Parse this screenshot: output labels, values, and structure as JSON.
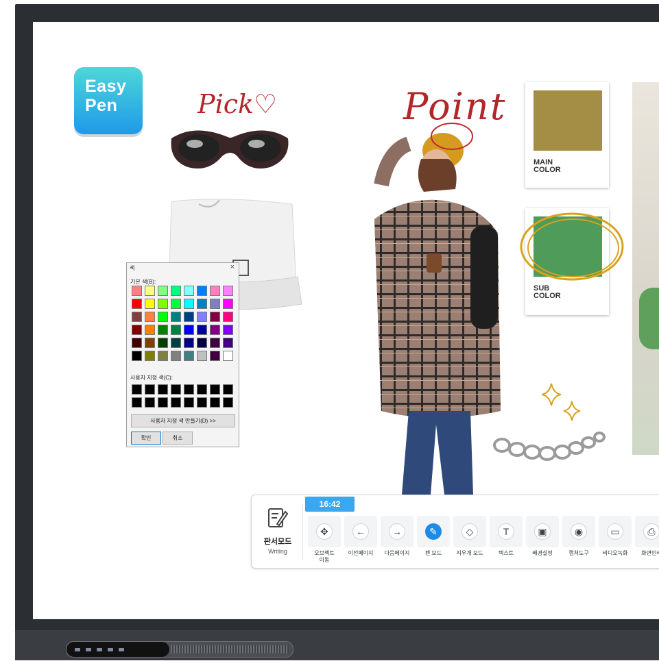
{
  "logo": {
    "line1": "Easy",
    "line2": "Pen"
  },
  "annotations": {
    "pick": "Pick♡",
    "point": "Point"
  },
  "swatches": {
    "main": {
      "label": "MAIN\nCOLOR",
      "color": "#a48d44"
    },
    "sub": {
      "label": "SUB\nCOLOR",
      "color": "#4f9b5a",
      "circle_color": "#d9a21b"
    }
  },
  "color_dialog": {
    "title": "색",
    "close": "×",
    "basic_label": "기본 색(B):",
    "custom_label": "사용자 지정 색(C):",
    "define_button": "사용자 지정 색 만들기(D) >>",
    "ok_button": "확인",
    "cancel_button": "취소",
    "basic_colors": [
      "#ff8080",
      "#ffff80",
      "#80ff80",
      "#00ff80",
      "#80ffff",
      "#0080ff",
      "#ff80c0",
      "#ff80ff",
      "#ff0000",
      "#ffff00",
      "#80ff00",
      "#00ff40",
      "#00ffff",
      "#0080c0",
      "#8080c0",
      "#ff00ff",
      "#804040",
      "#ff8040",
      "#00ff00",
      "#008080",
      "#004080",
      "#8080ff",
      "#800040",
      "#ff0080",
      "#800000",
      "#ff8000",
      "#008000",
      "#008040",
      "#0000ff",
      "#0000a0",
      "#800080",
      "#8000ff",
      "#400000",
      "#804000",
      "#004000",
      "#004040",
      "#000080",
      "#000040",
      "#400040",
      "#400080",
      "#000000",
      "#808000",
      "#808040",
      "#808080",
      "#408080",
      "#c0c0c0",
      "#400040",
      "#ffffff"
    ],
    "custom_colors": [
      "#000000",
      "#000000",
      "#000000",
      "#000000",
      "#000000",
      "#000000",
      "#000000",
      "#000000",
      "#000000",
      "#000000",
      "#000000",
      "#000000",
      "#000000",
      "#000000",
      "#000000",
      "#000000"
    ]
  },
  "toolbar": {
    "time": "16:42",
    "mode_title": "판서모드",
    "mode_subtitle": "Writing",
    "tools": [
      {
        "icon": "move-icon",
        "glyph": "✥",
        "label": "오브젝트\n이동",
        "active": false
      },
      {
        "icon": "arrow-left-icon",
        "glyph": "←",
        "label": "이전페이지",
        "active": false
      },
      {
        "icon": "arrow-right-icon",
        "glyph": "→",
        "label": "다음페이지",
        "active": false
      },
      {
        "icon": "pen-icon",
        "glyph": "✎",
        "label": "펜 모드",
        "active": true
      },
      {
        "icon": "eraser-icon",
        "glyph": "◇",
        "label": "지우개 모드",
        "active": false
      },
      {
        "icon": "text-icon",
        "glyph": "T",
        "label": "텍스트",
        "active": false
      },
      {
        "icon": "image-icon",
        "glyph": "▣",
        "label": "배경설정",
        "active": false
      },
      {
        "icon": "camera-icon",
        "glyph": "◉",
        "label": "캡처도구",
        "active": false
      },
      {
        "icon": "video-icon",
        "glyph": "▭",
        "label": "비디오녹화",
        "active": false
      },
      {
        "icon": "printer-icon",
        "glyph": "⎙",
        "label": "화면인쇄",
        "active": false
      }
    ]
  }
}
